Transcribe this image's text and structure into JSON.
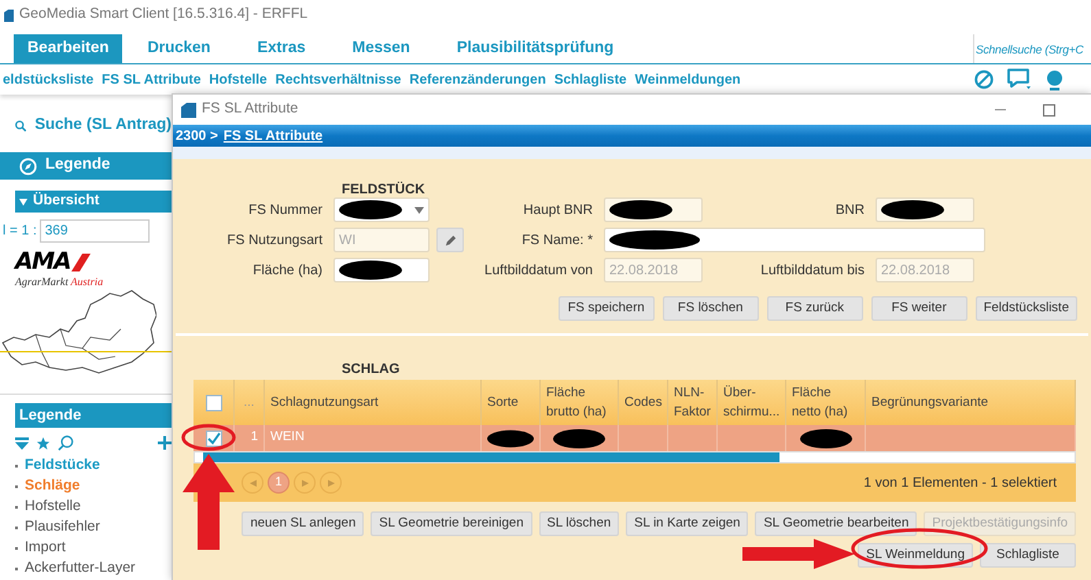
{
  "window": {
    "title": "GeoMedia Smart Client  [16.5.316.4] - ERFFL"
  },
  "ribbon_tabs": [
    {
      "label": "Bearbeiten",
      "selected": true
    },
    {
      "label": "Drucken",
      "selected": false
    },
    {
      "label": "Extras",
      "selected": false
    },
    {
      "label": "Messen",
      "selected": false
    },
    {
      "label": "Plausibilitätsprüfung",
      "selected": false
    }
  ],
  "quick_search": {
    "placeholder": "Schnellsuche (Strg+C"
  },
  "toolbar_links": [
    "eldstücksliste",
    "FS SL Attribute",
    "Hofstelle",
    "Rechtsverhältnisse",
    "Referenzänderungen",
    "Schlagliste",
    "Weinmeldungen"
  ],
  "left_panel": {
    "search_label": "Suche  (SL Antrag)",
    "legend_title": "Legende",
    "overview_title": "Übersicht",
    "scale_label": "l = 1 :",
    "scale_value": "369",
    "logo_mark": "AMA",
    "logo_tagline": "AgrarMarkt",
    "logo_tagline_accent": "Austria",
    "legend2_title": "Legende",
    "layers": [
      {
        "label": "Feldstücke",
        "color": "#1b9bc4",
        "bold": true
      },
      {
        "label": "Schläge",
        "color": "#f07d2c",
        "bold": true
      },
      {
        "label": "Hofstelle",
        "color": "#555555",
        "bold": false
      },
      {
        "label": "Plausifehler",
        "color": "#555555",
        "bold": false
      },
      {
        "label": "Import",
        "color": "#555555",
        "bold": false
      },
      {
        "label": "Ackerfutter-Layer",
        "color": "#555555",
        "bold": false
      }
    ]
  },
  "dialog": {
    "title": "FS SL Attribute",
    "breadcrumb_prefix": "2300 >",
    "breadcrumb_link": "FS SL Attribute",
    "fs_section": "FELDSTÜCK",
    "fs_rows": [
      [
        {
          "label": "FS Nummer",
          "kind": "select",
          "readonly": false,
          "redacted": true
        },
        {
          "label": "Haupt BNR",
          "kind": "text",
          "readonly": true,
          "redacted": true
        },
        {
          "label": "BNR",
          "kind": "text",
          "readonly": true,
          "redacted": true
        }
      ],
      [
        {
          "label": "FS Nutzungsart",
          "kind": "edit_text",
          "readonly": true,
          "redacted": false,
          "value": "WI"
        },
        {
          "label": "FS Name: *",
          "kind": "wide",
          "readonly": false,
          "redacted": true
        }
      ],
      [
        {
          "label": "Fläche (ha)",
          "kind": "text",
          "readonly": false,
          "redacted": true
        },
        {
          "label": "Luftbilddatum von",
          "kind": "text",
          "readonly": true,
          "redacted": false,
          "value": "22.08.2018"
        },
        {
          "label": "Luftbilddatum bis",
          "kind": "text",
          "readonly": true,
          "redacted": false,
          "value": "22.08.2018"
        }
      ]
    ],
    "fs_buttons": [
      "FS speichern",
      "FS löschen",
      "FS zurück",
      "FS weiter",
      "Feldstücksliste"
    ],
    "sl_section": "SCHLAG",
    "table": {
      "select_all": {
        "checked": false
      },
      "columns": [
        "...",
        "Schlagnutzungsart",
        "Sorte",
        "Fläche brutto (ha)",
        "Codes",
        "NLN-Faktor",
        "Über-schirmu...",
        "Fläche netto (ha)",
        "Begrünungsvariante"
      ],
      "rows": [
        {
          "selected": true,
          "cells": [
            {
              "text": "1",
              "redacted": false
            },
            {
              "text": "WEIN",
              "redacted": false
            },
            {
              "redacted": true
            },
            {
              "redacted": true
            },
            {
              "redacted": false
            },
            {
              "redacted": false
            },
            {
              "redacted": false
            },
            {
              "redacted": true
            },
            {
              "redacted": false
            }
          ]
        }
      ]
    },
    "pager": {
      "pages": [
        {
          "label": "1",
          "selected": true
        }
      ],
      "status": "1 von 1 Elementen - 1 selektiert"
    },
    "sl_buttons": [
      {
        "label": "neuen SL anlegen",
        "disabled": false
      },
      {
        "label": "SL Geometrie bereinigen",
        "disabled": false
      },
      {
        "label": "SL löschen",
        "disabled": false
      },
      {
        "label": "SL in Karte zeigen",
        "disabled": false
      },
      {
        "label": "SL Geometrie bearbeiten",
        "disabled": false
      },
      {
        "label": "Projektbestätigungsinfo",
        "disabled": true
      }
    ],
    "bottom_buttons": [
      "SL Weinmeldung",
      "Schlagliste"
    ]
  }
}
